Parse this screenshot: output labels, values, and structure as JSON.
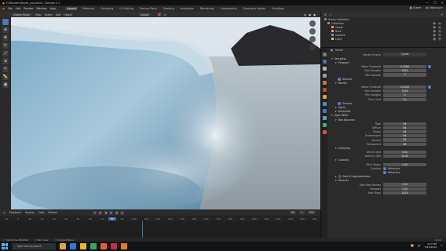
{
  "window": {
    "title": "F:\\Blender\\Waves_wip.blend - Blender 4.1",
    "controls": [
      "—",
      "❐",
      "✕"
    ]
  },
  "menubar": {
    "menus": [
      "File",
      "Edit",
      "Render",
      "Window",
      "Help"
    ],
    "tabs": [
      "Layout",
      "Modeling",
      "Sculpting",
      "UV Editing",
      "Texture Paint",
      "Shading",
      "Animation",
      "Rendering",
      "Compositing",
      "Geometry Nodes",
      "Scripting"
    ],
    "active_tab": "Layout",
    "scene": "Scene",
    "view_layer": "ViewLayer"
  },
  "viewport_header": {
    "mode": "Object Mode",
    "menus": [
      "View",
      "Select",
      "Add",
      "Object"
    ],
    "orientation": "Global"
  },
  "toolbar": {
    "tools": [
      "cursor-select-icon",
      "cursor-icon",
      "move-icon",
      "rotate-icon",
      "scale-icon",
      "transform-icon",
      "annotate-icon",
      "measure-icon",
      "add-cube-icon"
    ],
    "active": 0
  },
  "timeline": {
    "menus": [
      "Playback",
      "Keying",
      "View",
      "Marker"
    ],
    "current_frame": "80",
    "start": "1",
    "end": "250",
    "ticks": [
      "-10",
      "0",
      "10",
      "20",
      "30",
      "40",
      "50",
      "60",
      "70",
      "80",
      "90",
      "100",
      "110",
      "120",
      "130",
      "140",
      "150",
      "160",
      "170",
      "180",
      "190",
      "200",
      "210",
      "220",
      "230",
      "240",
      "250"
    ]
  },
  "statusbar": {
    "items": [
      "Set Active Modifier",
      "Pan View",
      "Context Menu"
    ],
    "version": "4.1.0"
  },
  "taskbar": {
    "search_placeholder": "Type here to search",
    "time": "4:27 PM",
    "date": "5/14/2024",
    "icon_colors": [
      "#e8a33d",
      "#2d7bd6",
      "#f0b429",
      "#3aa655",
      "#e85c2b",
      "#c72e3a",
      "#e87d0d"
    ]
  },
  "outliner": {
    "title": "Scene Collection",
    "items": [
      "Collection",
      "Ocean",
      "Rock",
      "Camera",
      "Light"
    ]
  },
  "properties": {
    "header": "Scene",
    "render_engine_label": "Render Engine",
    "render_engine": "Cycles",
    "sections": {
      "sampling": "Sampling",
      "viewport": "Viewport",
      "render": "Render",
      "lights": "Lights",
      "advanced": "Advanced",
      "light_paths": "Light Paths",
      "max_bounces": "Max Bounces",
      "clamping": "Clamping",
      "caustics": "Caustics",
      "fast_gi": "Fast GI Approximation",
      "volumes": "Volumes"
    },
    "viewport_rows": [
      {
        "label": "Noise Threshold",
        "value": "0.1000",
        "checked": true
      },
      {
        "label": "Max Samples",
        "value": "1024"
      },
      {
        "label": "Min Samples",
        "value": "0"
      }
    ],
    "viewport_denoise": "Denoise",
    "render_rows": [
      {
        "label": "Noise Threshold",
        "value": "0.0100",
        "checked": true
      },
      {
        "label": "Max Samples",
        "value": "1024"
      },
      {
        "label": "Min Samples",
        "value": "0"
      },
      {
        "label": "Time Limit",
        "value": "0 s"
      }
    ],
    "render_denoise": "Denoise",
    "bounce_rows": [
      {
        "label": "Total",
        "value": "64"
      },
      {
        "label": "Diffuse",
        "value": "64"
      },
      {
        "label": "Glossy",
        "value": "64"
      },
      {
        "label": "Transmission",
        "value": "64"
      },
      {
        "label": "Volume",
        "value": "64"
      },
      {
        "label": "Transparent",
        "value": "64"
      }
    ],
    "clamp_rows": [
      {
        "label": "Direct Light",
        "value": "0.00"
      },
      {
        "label": "Indirect Light",
        "value": "10.00"
      }
    ],
    "caustics_rows": [
      {
        "label": "Filter Glossy",
        "value": "1.00"
      }
    ],
    "caustics_checks": {
      "label": "Caustics",
      "reflective": "Reflective",
      "refractive": "Refractive"
    },
    "volume_rows": [
      {
        "label": "Step Rate Render",
        "value": "1.00"
      },
      {
        "label": "Viewport",
        "value": "1.00"
      },
      {
        "label": "Max Steps",
        "value": "1024"
      }
    ]
  }
}
